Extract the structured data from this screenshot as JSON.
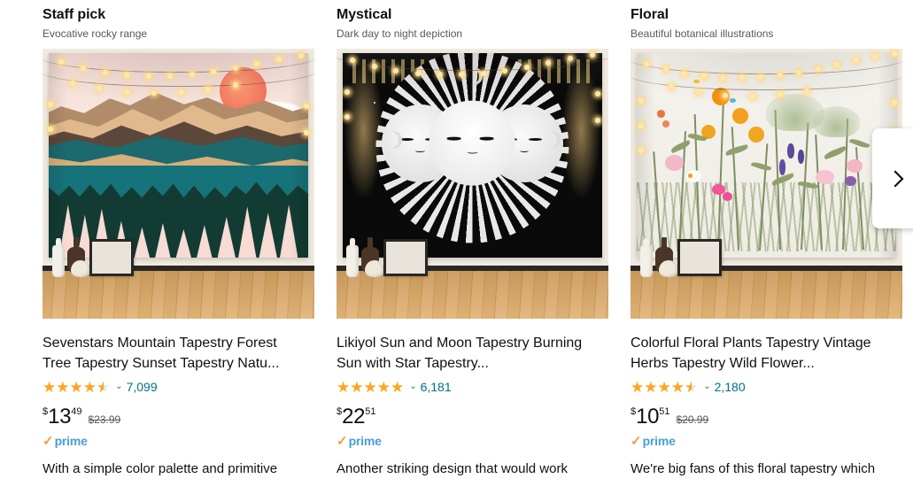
{
  "carousel": {
    "next_button": {
      "icon": "chevron-right-icon",
      "label": ">"
    },
    "cards": [
      {
        "heading": "Staff pick",
        "subheading": "Evocative rocky range",
        "image_alt": "Mountain sunset tapestry hung on wall with string lights above a wood floor",
        "title": "Sevenstars Mountain Tapestry Forest Tree Tapestry Sunset Tapestry Natu...",
        "rating_value": 4.5,
        "rating_count": "7,099",
        "price_symbol": "$",
        "price_whole": "13",
        "price_fraction": "49",
        "old_price": "$23.99",
        "prime": {
          "check": "✓",
          "label": "prime"
        },
        "blurb": "With a simple color palette and primitive"
      },
      {
        "heading": "Mystical",
        "subheading": "Dark day to night depiction",
        "image_alt": "Black and white sun and moon faces mandala tapestry with string lights",
        "title": "Likiyol Sun and Moon Tapestry Burning Sun with Star Tapestry...",
        "rating_value": 5,
        "rating_count": "6,181",
        "price_symbol": "$",
        "price_whole": "22",
        "price_fraction": "51",
        "old_price": "",
        "prime": {
          "check": "✓",
          "label": "prime"
        },
        "blurb": "Another striking design that would work"
      },
      {
        "heading": "Floral",
        "subheading": "Beautiful botanical illustrations",
        "image_alt": "Colorful wildflower and herb botanical tapestry with warm string lights",
        "title": "Colorful Floral Plants Tapestry Vintage Herbs Tapestry Wild Flower...",
        "rating_value": 4.5,
        "rating_count": "2,180",
        "price_symbol": "$",
        "price_whole": "10",
        "price_fraction": "51",
        "old_price": "$20.99",
        "prime": {
          "check": "✓",
          "label": "prime"
        },
        "blurb": "We're big fans of this floral tapestry which"
      }
    ]
  },
  "colors": {
    "star": "#ffa41c",
    "star_empty": "#e3e6e6",
    "link": "#007185",
    "text": "#0f1111",
    "muted": "#565959",
    "prime_blue": "#4a9fd4",
    "prime_orange": "#f79b34"
  }
}
